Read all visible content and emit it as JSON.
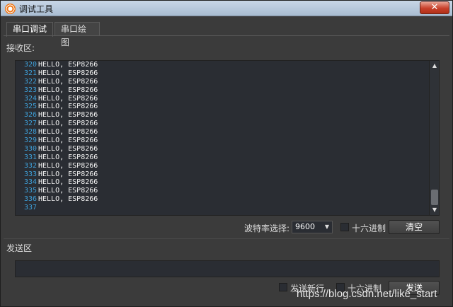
{
  "window": {
    "title": "调试工具",
    "close_label": "✕"
  },
  "tabs": [
    {
      "label": "串口调试",
      "active": true
    },
    {
      "label": "串口绘图",
      "active": false
    }
  ],
  "receive": {
    "label": "接收区:",
    "lines": [
      {
        "num": "320",
        "text": "HELLO, ESP8266"
      },
      {
        "num": "321",
        "text": "HELLO, ESP8266"
      },
      {
        "num": "322",
        "text": "HELLO, ESP8266"
      },
      {
        "num": "323",
        "text": "HELLO, ESP8266"
      },
      {
        "num": "324",
        "text": "HELLO, ESP8266"
      },
      {
        "num": "325",
        "text": "HELLO, ESP8266"
      },
      {
        "num": "326",
        "text": "HELLO, ESP8266"
      },
      {
        "num": "327",
        "text": "HELLO, ESP8266"
      },
      {
        "num": "328",
        "text": "HELLO, ESP8266"
      },
      {
        "num": "329",
        "text": "HELLO, ESP8266"
      },
      {
        "num": "330",
        "text": "HELLO, ESP8266"
      },
      {
        "num": "331",
        "text": "HELLO, ESP8266"
      },
      {
        "num": "332",
        "text": "HELLO, ESP8266"
      },
      {
        "num": "333",
        "text": "HELLO, ESP8266"
      },
      {
        "num": "334",
        "text": "HELLO, ESP8266"
      },
      {
        "num": "335",
        "text": "HELLO, ESP8266"
      },
      {
        "num": "336",
        "text": "HELLO, ESP8266"
      },
      {
        "num": "337",
        "text": ""
      }
    ]
  },
  "controls": {
    "baud_label": "波特率选择:",
    "baud_value": "9600",
    "hex_recv_label": "十六进制",
    "clear_label": "清空"
  },
  "send": {
    "label": "发送区",
    "input_value": "",
    "newline_label": "发送新行",
    "hex_send_label": "十六进制",
    "send_label": "发送"
  },
  "watermark": "https://blog.csdn.net/like_start",
  "colors": {
    "line_number": "#3e9fd8",
    "text_area_bg": "#2a2d33",
    "window_bg": "#3b3b3b"
  }
}
